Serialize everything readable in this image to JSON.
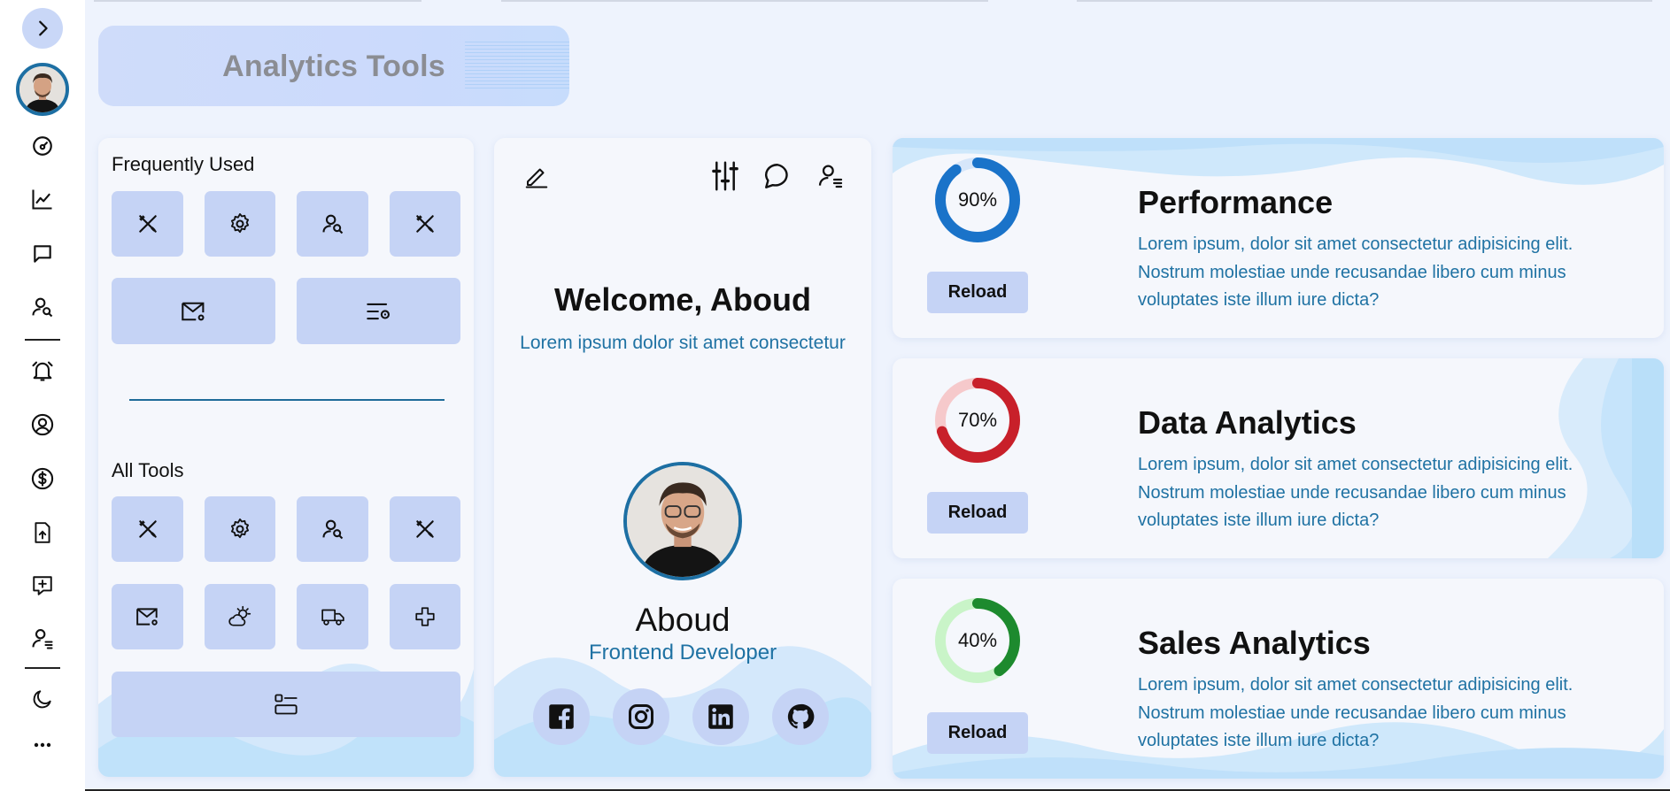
{
  "header": {
    "title": "Analytics Tools"
  },
  "tools": {
    "frequently_used_title": "Frequently Used",
    "all_tools_title": "All Tools"
  },
  "profile": {
    "welcome": "Welcome, Aboud",
    "subtitle": "Lorem ipsum dolor sit amet consectetur",
    "name": "Aboud",
    "role": "Frontend Developer"
  },
  "analytics": [
    {
      "title": "Performance",
      "percent_label": "90%",
      "progress": 0.9,
      "color": "#1a73c9",
      "track": "#d6e6fa",
      "description": "Lorem ipsum, dolor sit amet consectetur adipisicing elit. Nostrum molestiae unde recusandae libero cum minus voluptates iste illum iure dicta?",
      "reload_label": "Reload"
    },
    {
      "title": "Data Analytics",
      "percent_label": "70%",
      "progress": 0.7,
      "color": "#c8202a",
      "track": "#f6c9cb",
      "description": "Lorem ipsum, dolor sit amet consectetur adipisicing elit. Nostrum molestiae unde recusandae libero cum minus voluptates iste illum iure dicta?",
      "reload_label": "Reload"
    },
    {
      "title": "Sales Analytics",
      "percent_label": "40%",
      "progress": 0.4,
      "color": "#1d8a2e",
      "track": "#c9f4c8",
      "description": "Lorem ipsum, dolor sit amet consectetur adipisicing elit. Nostrum molestiae unde recusandae libero cum minus voluptates iste illum iure dicta?",
      "reload_label": "Reload"
    }
  ],
  "colors": {
    "accent": "#1f72a3",
    "button_bg": "#c5d3f5",
    "page_bg": "#eef3fd"
  }
}
